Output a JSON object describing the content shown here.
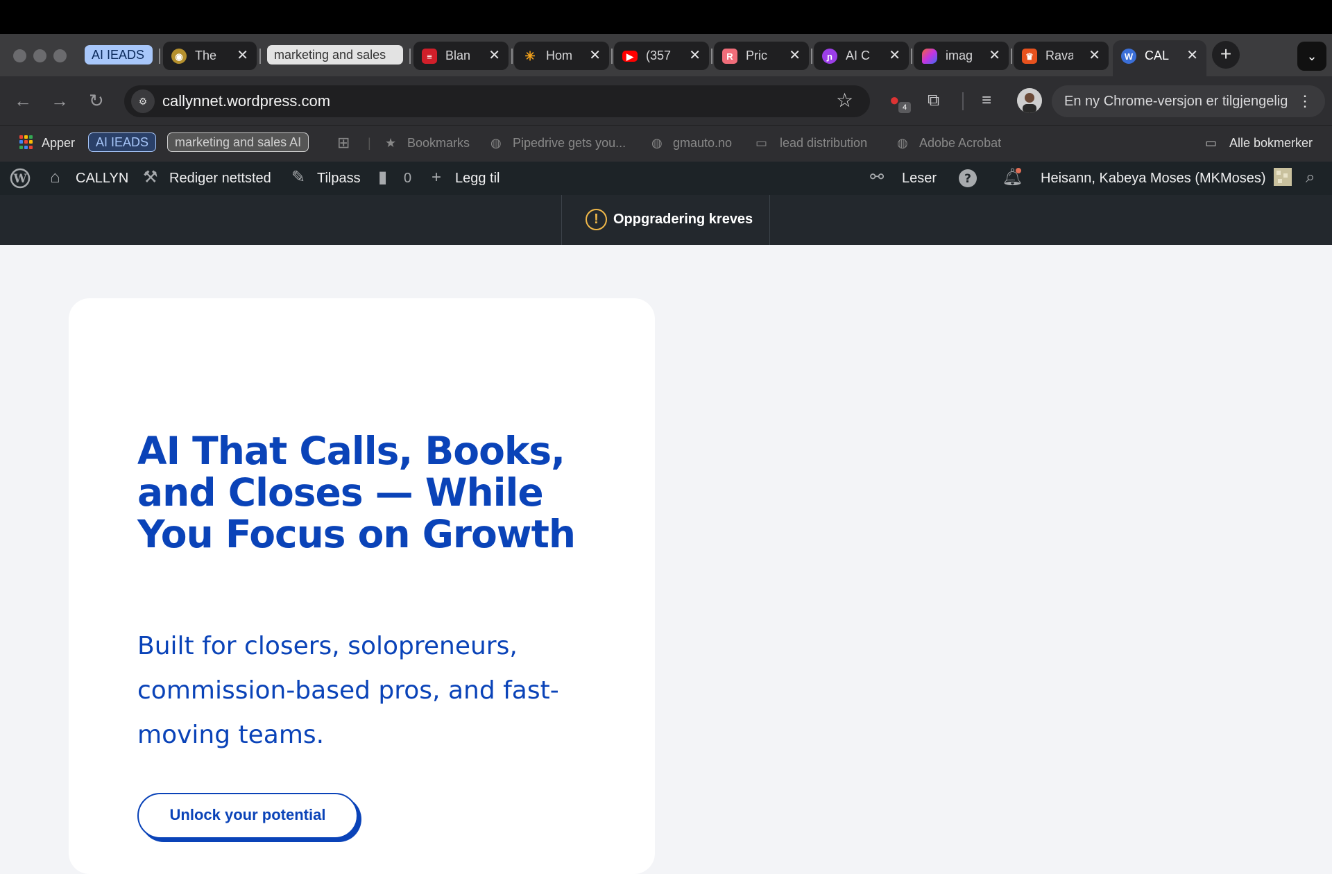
{
  "browser": {
    "tab_groups": {
      "ai_ieads": "AI IEADS",
      "marketing": "marketing and sales"
    },
    "tabs": [
      {
        "title": "The",
        "favicon": "chrome-icon"
      },
      {
        "title": "Blan",
        "favicon": "blank-icon"
      },
      {
        "title": "Hom",
        "favicon": "sunburst-icon"
      },
      {
        "title": "(357",
        "favicon": "youtube-icon"
      },
      {
        "title": "Pric",
        "favicon": "pricing-icon"
      },
      {
        "title": "AI C",
        "favicon": "ai-icon"
      },
      {
        "title": "imag",
        "favicon": "image-icon"
      },
      {
        "title": "Rava",
        "favicon": "rava-icon"
      },
      {
        "title": "CAL",
        "favicon": "wordpress-icon",
        "active": true
      }
    ],
    "close_glyph": "✕",
    "new_tab_glyph": "+",
    "url": "callynnet.wordpress.com",
    "extension_badge": "4",
    "update_text": "En ny Chrome-versjon er tilgjengelig",
    "bookmarks": {
      "apps": "Apper",
      "group_ai": "AI IEADS",
      "group_marketing": "marketing and sales AI",
      "bookmarks": "Bookmarks",
      "pipedrive": "Pipedrive gets you...",
      "gmauto": "gmauto.no",
      "lead": "lead distribution",
      "acrobat": "Adobe Acrobat",
      "all": "Alle bokmerker"
    }
  },
  "wp_admin_bar": {
    "site": "CALLYN",
    "edit_site": "Rediger nettsted",
    "customize": "Tilpass",
    "comments": "0",
    "add_new": "Legg til",
    "reader": "Leser",
    "greeting": "Heisann, Kabeya Moses (MKMoses)"
  },
  "upgrade": {
    "icon_glyph": "!",
    "text": "Oppgradering kreves"
  },
  "hero": {
    "title": "AI That Calls, Books, and Closes — While You Focus on Growth",
    "subtitle": "Built for closers, solopreneurs, commission-based pros, and fast-moving teams.",
    "cta": "Unlock your potential"
  },
  "colors": {
    "brand_blue": "#0a43b8",
    "wp_bar": "#1d2327",
    "upgrade_warning": "#f0b849"
  }
}
